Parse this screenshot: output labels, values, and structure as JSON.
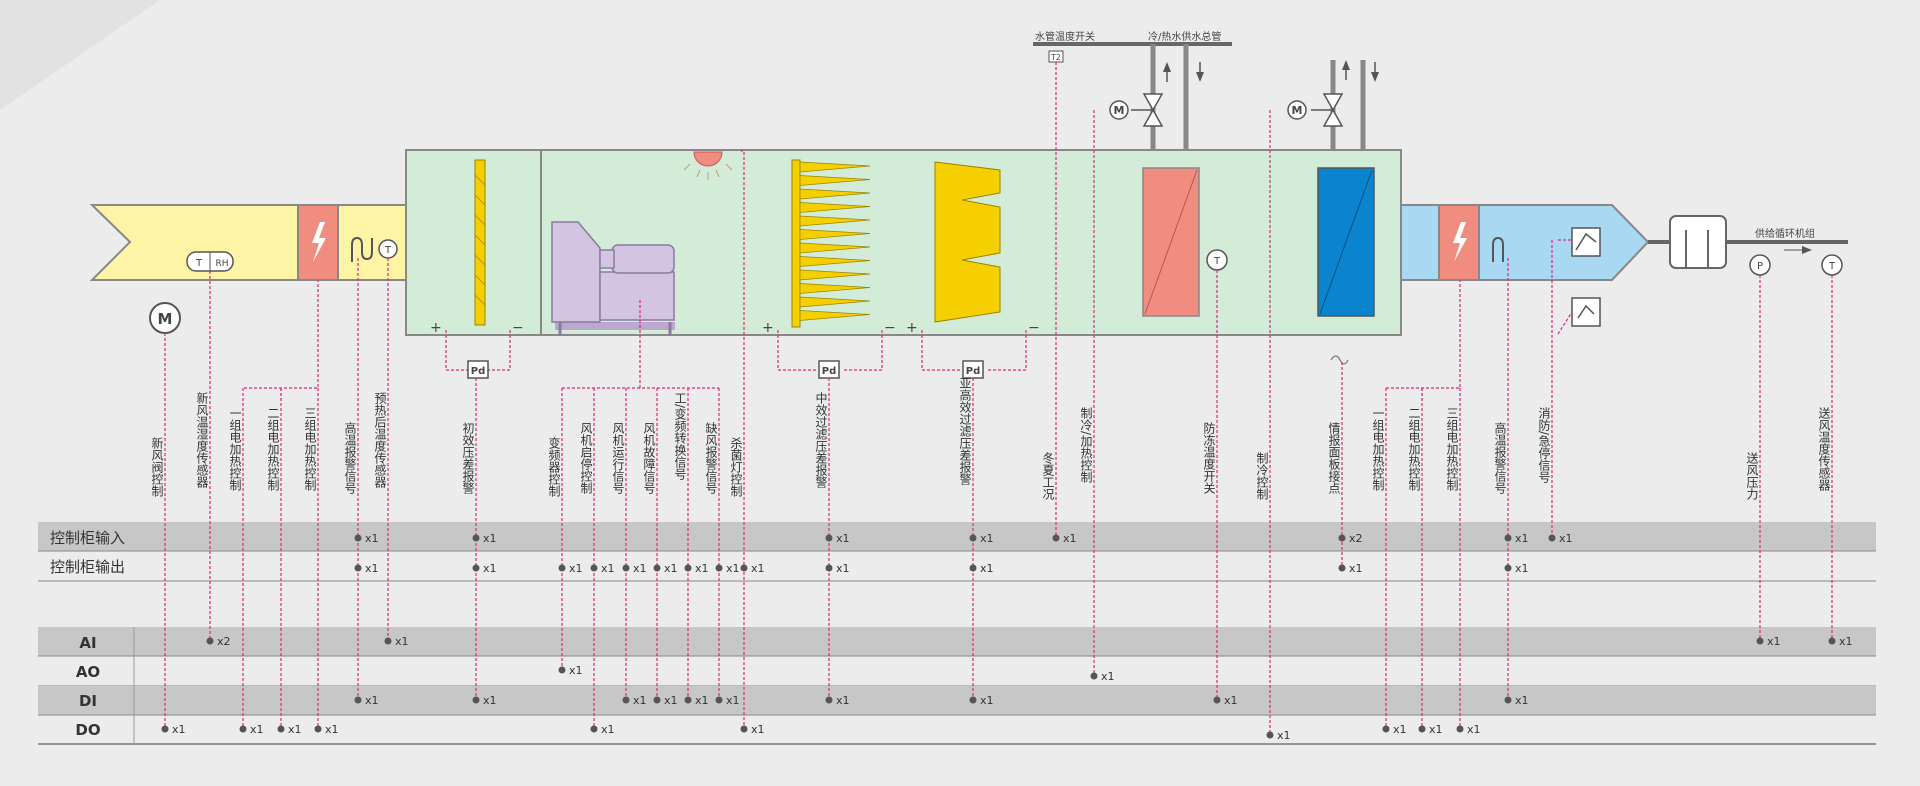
{
  "colors": {
    "background": "#ececec",
    "band": "#c7c7c7",
    "duct_fresh": "#fdf5a5",
    "duct_supply": "#a9d8f2",
    "unit_body": "#d2ecd7",
    "heater": "#f08c80",
    "filter": "#f6cf00",
    "fan": "#d3c4e2",
    "cooling_coil": "#0b84cf",
    "signal": "#e0267f",
    "dot": "#555555"
  },
  "pipe_labels": {
    "switch": "水管温度开关",
    "main": "冷/热水供水总管",
    "supply_out": "供给循环机组"
  },
  "symbols": {
    "motor": "M",
    "temp": "T",
    "humid": "RH",
    "pressure_diff": "Pd",
    "pressure": "P",
    "pipe_temp": "T2",
    "plus": "+",
    "minus": "−"
  },
  "rows": {
    "cab_in": "控制柜输入",
    "cab_out": "控制柜输出",
    "ai": "AI",
    "ao": "AO",
    "di": "DI",
    "do": "DO"
  },
  "columns": [
    {
      "id": "c1",
      "label": "新风阀控制"
    },
    {
      "id": "c2",
      "label": "新风温湿度传感器"
    },
    {
      "id": "c3",
      "label": "一组电加热控制"
    },
    {
      "id": "c4",
      "label": "二组电加热控制"
    },
    {
      "id": "c5",
      "label": "三组电加热控制"
    },
    {
      "id": "c6",
      "label": "高温报警信号"
    },
    {
      "id": "c7",
      "label": "预热后温度传感器"
    },
    {
      "id": "c8",
      "label": "初效压差报警"
    },
    {
      "id": "c9",
      "label": "变频器控制"
    },
    {
      "id": "c10",
      "label": "风机启停控制"
    },
    {
      "id": "c11",
      "label": "风机运行信号"
    },
    {
      "id": "c12",
      "label": "风机故障信号"
    },
    {
      "id": "c13",
      "label": "工/变频转换信号"
    },
    {
      "id": "c14",
      "label": "缺风报警信号"
    },
    {
      "id": "c15",
      "label": "杀菌灯控制"
    },
    {
      "id": "c16",
      "label": "中效过滤压差报警"
    },
    {
      "id": "c17",
      "label": "亚高效过滤压差报警"
    },
    {
      "id": "c18",
      "label": "冬夏工况"
    },
    {
      "id": "c19",
      "label": "制冷/加热控制"
    },
    {
      "id": "c20",
      "label": "防冻温度开关"
    },
    {
      "id": "c21",
      "label": "制冷控制"
    },
    {
      "id": "c22",
      "label": "情报面板接点"
    },
    {
      "id": "c23",
      "label": "一组电加热控制"
    },
    {
      "id": "c24",
      "label": "二组电加热控制"
    },
    {
      "id": "c25",
      "label": "三组电加热控制"
    },
    {
      "id": "c26",
      "label": "高温报警信号"
    },
    {
      "id": "c27",
      "label": "消防/急停信号"
    },
    {
      "id": "c28",
      "label": "送风压力"
    },
    {
      "id": "c29",
      "label": "送风温度传感器"
    }
  ],
  "connections": [
    {
      "col": "c1",
      "row": "do",
      "count": "x1"
    },
    {
      "col": "c2",
      "row": "ai",
      "count": "x2"
    },
    {
      "col": "c3",
      "row": "do",
      "count": "x1"
    },
    {
      "col": "c4",
      "row": "do",
      "count": "x1"
    },
    {
      "col": "c5",
      "row": "do",
      "count": "x1"
    },
    {
      "col": "c6",
      "row": "cab_in",
      "count": "x1"
    },
    {
      "col": "c6",
      "row": "cab_out",
      "count": "x1"
    },
    {
      "col": "c6",
      "row": "di",
      "count": "x1"
    },
    {
      "col": "c7",
      "row": "ai",
      "count": "x1"
    },
    {
      "col": "c8",
      "row": "cab_in",
      "count": "x1"
    },
    {
      "col": "c8",
      "row": "cab_out",
      "count": "x1"
    },
    {
      "col": "c8",
      "row": "di",
      "count": "x1"
    },
    {
      "col": "c9",
      "row": "cab_out",
      "count": "x1"
    },
    {
      "col": "c9",
      "row": "ao",
      "count": "x1"
    },
    {
      "col": "c10",
      "row": "cab_out",
      "count": "x1"
    },
    {
      "col": "c10",
      "row": "do",
      "count": "x1"
    },
    {
      "col": "c11",
      "row": "cab_out",
      "count": "x1"
    },
    {
      "col": "c11",
      "row": "di",
      "count": "x1"
    },
    {
      "col": "c12",
      "row": "cab_out",
      "count": "x1"
    },
    {
      "col": "c12",
      "row": "di",
      "count": "x1"
    },
    {
      "col": "c13",
      "row": "cab_out",
      "count": "x1"
    },
    {
      "col": "c13",
      "row": "di",
      "count": "x1"
    },
    {
      "col": "c14",
      "row": "cab_out",
      "count": "x1"
    },
    {
      "col": "c14",
      "row": "di",
      "count": "x1"
    },
    {
      "col": "c15",
      "row": "cab_out",
      "count": "x1"
    },
    {
      "col": "c15",
      "row": "do",
      "count": "x1"
    },
    {
      "col": "c16",
      "row": "cab_in",
      "count": "x1"
    },
    {
      "col": "c16",
      "row": "cab_out",
      "count": "x1"
    },
    {
      "col": "c16",
      "row": "di",
      "count": "x1"
    },
    {
      "col": "c17",
      "row": "cab_in",
      "count": "x1"
    },
    {
      "col": "c17",
      "row": "cab_out",
      "count": "x1"
    },
    {
      "col": "c17",
      "row": "di",
      "count": "x1"
    },
    {
      "col": "c18",
      "row": "cab_in",
      "count": "x1"
    },
    {
      "col": "c19",
      "row": "ao",
      "count": "x1"
    },
    {
      "col": "c20",
      "row": "di",
      "count": "x1"
    },
    {
      "col": "c21",
      "row": "do",
      "count": "x1"
    },
    {
      "col": "c22",
      "row": "cab_in",
      "count": "x2"
    },
    {
      "col": "c22",
      "row": "cab_out",
      "count": "x1"
    },
    {
      "col": "c23",
      "row": "do",
      "count": "x1"
    },
    {
      "col": "c24",
      "row": "do",
      "count": "x1"
    },
    {
      "col": "c25",
      "row": "do",
      "count": "x1"
    },
    {
      "col": "c26",
      "row": "cab_in",
      "count": "x1"
    },
    {
      "col": "c26",
      "row": "cab_out",
      "count": "x1"
    },
    {
      "col": "c26",
      "row": "di",
      "count": "x1"
    },
    {
      "col": "c27",
      "row": "cab_in",
      "count": "x1"
    },
    {
      "col": "c28",
      "row": "ai",
      "count": "x1"
    },
    {
      "col": "c29",
      "row": "ai",
      "count": "x1"
    }
  ]
}
